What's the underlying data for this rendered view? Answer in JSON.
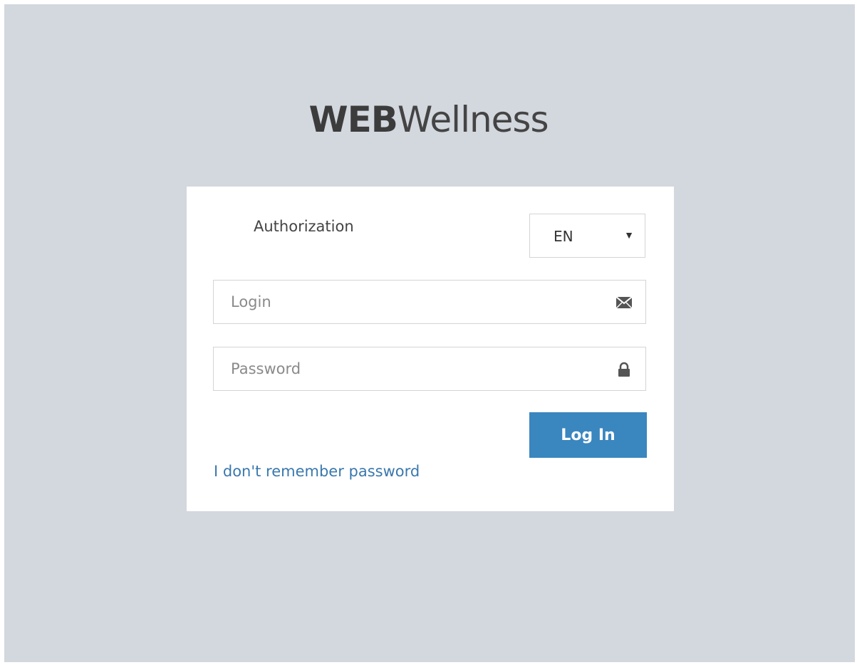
{
  "logo": {
    "bold": "WEB",
    "light": "Wellness"
  },
  "auth_card": {
    "title": "Authorization",
    "language": {
      "selected": "EN",
      "chevron_icon": "triangle-down"
    },
    "login_field": {
      "placeholder": "Login",
      "value": "",
      "icon": "envelope-icon"
    },
    "password_field": {
      "placeholder": "Password",
      "value": "",
      "icon": "lock-icon"
    },
    "submit_label": "Log In",
    "forgot_link": "I don't remember password"
  },
  "colors": {
    "background": "#d3d7de",
    "card": "#ffffff",
    "primary_button": "#3a86bf",
    "link": "#3a78ad"
  }
}
